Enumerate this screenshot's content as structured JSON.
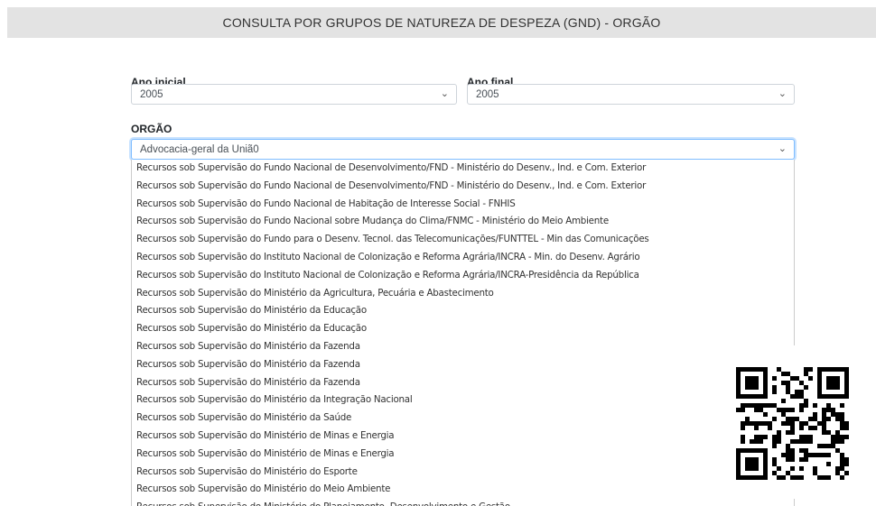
{
  "header": {
    "title": "CONSULTA POR GRUPOS DE NATUREZA DE DESPEZA (GND) - ORGÃO"
  },
  "form": {
    "ano_inicial": {
      "label": "Ano inicial",
      "value": "2005"
    },
    "ano_final": {
      "label": "Ano final",
      "value": "2005"
    },
    "orgao": {
      "label": "ORGÃO",
      "value": "Advocacia-geral da Uniã0"
    }
  },
  "dropdown": {
    "options": [
      "Recursos sob Supervisão do Fundo Nacional de Desenvolvimento/FND - Ministério do Desenv., Ind. e Com. Exterior",
      "Recursos sob Supervisão do Fundo Nacional de Desenvolvimento/FND - Ministério do Desenv., Ind. e Com. Exterior",
      "Recursos sob Supervisão do Fundo Nacional de Habitação de Interesse Social - FNHIS",
      "Recursos sob Supervisão do Fundo Nacional sobre Mudança do Clima/FNMC - Ministério do Meio Ambiente",
      "Recursos sob Supervisão do Fundo para o Desenv. Tecnol. das Telecomunicações/FUNTTEL - Min das Comunicações",
      "Recursos sob Supervisão do Instituto Nacional de Colonização e Reforma Agrária/INCRA - Min. do Desenv. Agrário",
      "Recursos sob Supervisão do Instituto Nacional de Colonização e Reforma Agrária/INCRA-Presidência da República",
      "Recursos sob Supervisão do Ministério da Agricultura, Pecuária e Abastecimento",
      "Recursos sob Supervisão do Ministério da Educação",
      "Recursos sob Supervisão do Ministério da Educação",
      "Recursos sob Supervisão do Ministério da Fazenda",
      "Recursos sob Supervisão do Ministério da Fazenda",
      "Recursos sob Supervisão do Ministério da Fazenda",
      "Recursos sob Supervisão do Ministério da Integração Nacional",
      "Recursos sob Supervisão do Ministério da Saúde",
      "Recursos sob Supervisão do Ministério de Minas e Energia",
      "Recursos sob Supervisão do Ministério de Minas e Energia",
      "Recursos sob Supervisão do Ministério do Esporte",
      "Recursos sob Supervisão do Ministério do Meio Ambiente",
      "Recursos sob Supervisão do Ministério do Planejamento, Desenvolvimento e Gestão"
    ]
  },
  "icons": {
    "select_chevron": "chevron-down-icon",
    "qr": "qr-code"
  },
  "colors": {
    "header_bg": "#e3e3e3",
    "focus_border": "#80bdff"
  }
}
